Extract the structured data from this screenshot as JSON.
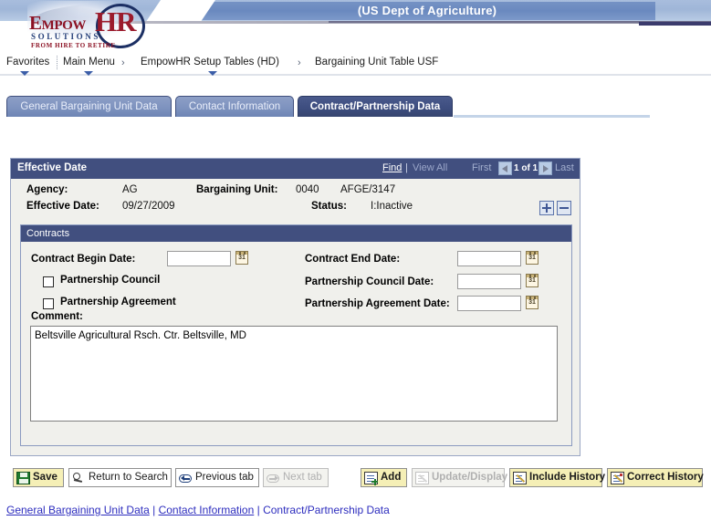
{
  "header": {
    "banner_title": "(US Dept of Agriculture)",
    "logo": {
      "empow": "Empow",
      "hr": "HR",
      "solutions": "SOLUTIONS",
      "tagline": "FROM HIRE TO RETIRE"
    }
  },
  "breadcrumb": {
    "favorites": "Favorites",
    "main_menu": "Main Menu",
    "arrow": "›",
    "item2": "EmpowHR Setup Tables (HD)",
    "item3": "Bargaining Unit Table USF"
  },
  "tabs": [
    {
      "label": "General Bargaining Unit Data",
      "active": false
    },
    {
      "label": "Contact Information",
      "active": false
    },
    {
      "label": "Contract/Partnership Data",
      "active": true
    }
  ],
  "panel": {
    "title": "Effective Date",
    "find_label": "Find",
    "pipe": "|",
    "view_all_label": "View All",
    "first_label": "First",
    "last_label": "Last",
    "row_count": "1 of 1",
    "add_row_title": "+",
    "delete_row_title": "−",
    "fields": {
      "agency_label": "Agency:",
      "agency_value": "AG",
      "bargaining_unit_label": "Bargaining Unit:",
      "bargaining_unit_value": "0040",
      "bargaining_unit_name": "AFGE/3147",
      "effective_date_label": "Effective Date:",
      "effective_date_value": "09/27/2009",
      "status_label": "Status:",
      "status_value": "I:Inactive"
    }
  },
  "contracts": {
    "title": "Contracts",
    "contract_begin_date": {
      "label": "Contract Begin Date:",
      "value": "",
      "calendar_day": "31"
    },
    "contract_end_date": {
      "label": "Contract End Date:",
      "value": "",
      "calendar_day": "31"
    },
    "partnership_council": {
      "label": "Partnership Council",
      "checked": false
    },
    "partnership_council_date": {
      "label": "Partnership Council Date:",
      "value": "",
      "calendar_day": "31"
    },
    "partnership_agreement": {
      "label": "Partnership Agreement",
      "checked": false
    },
    "partnership_agreement_date": {
      "label": "Partnership Agreement Date:",
      "value": "",
      "calendar_day": "31"
    },
    "comment": {
      "label": "Comment:",
      "value": "Beltsville Agricultural Rsch. Ctr. Beltsville, MD"
    }
  },
  "toolbar": {
    "save": "Save",
    "return_to_search": "Return to Search",
    "previous_tab": "Previous tab",
    "next_tab": "Next tab",
    "add": "Add",
    "update_display": "Update/Display",
    "include_history": "Include History",
    "correct_history": "Correct History"
  },
  "footer": {
    "link1": "General Bargaining Unit Data",
    "sep1": " | ",
    "link2": "Contact Information",
    "sep2": " | ",
    "link3": "Contract/Partnership Data"
  },
  "colors": {
    "header_navy": "#414f7f",
    "banner_blue": "#7592c4",
    "tab_active": "#3e4e80",
    "button_yellow": "#f5efb6",
    "link_blue": "#2d2dbe",
    "logo_red": "#9b1b2c"
  }
}
